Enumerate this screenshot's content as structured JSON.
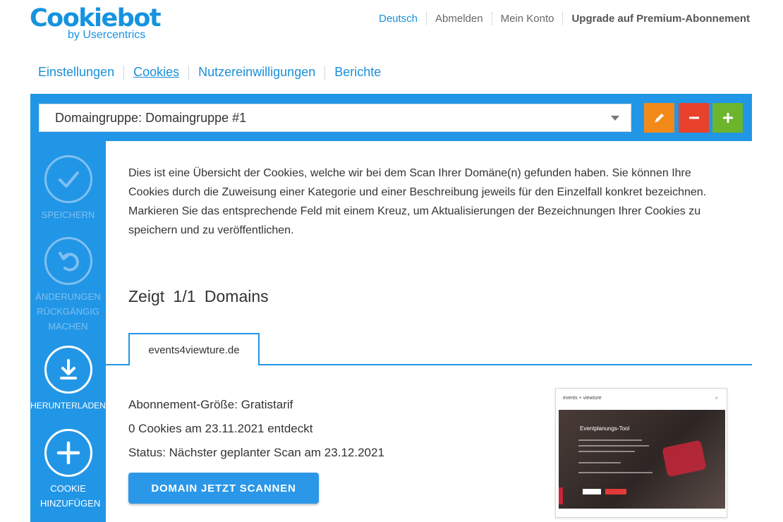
{
  "brand": {
    "name": "Cookiebot",
    "sub": "by Usercentrics",
    "color": "#1593e0"
  },
  "topnav": {
    "language": "Deutsch",
    "logout": "Abmelden",
    "account": "Mein Konto",
    "upgrade": "Upgrade auf Premium-Abonnement"
  },
  "mainnav": {
    "tabs": [
      "Einstellungen",
      "Cookies",
      "Nutzereinwilligungen",
      "Berichte"
    ],
    "active": "Cookies"
  },
  "domain_group": {
    "selected": "Domaingruppe: Domaingruppe #1",
    "buttons": {
      "edit_icon": "pencil-icon",
      "delete_icon": "minus-icon",
      "add_icon": "plus-icon"
    }
  },
  "actions": [
    {
      "label": "SPEICHERN",
      "icon": "checkmark-icon",
      "enabled": false
    },
    {
      "label": "ÄNDERUNGEN RÜCKGÄNGIG MACHEN",
      "icon": "undo-icon",
      "enabled": false
    },
    {
      "label": "HERUNTERLADEN",
      "icon": "download-icon",
      "enabled": true
    },
    {
      "label": "COOKIE HINZUFÜGEN",
      "icon": "add-circle-icon",
      "enabled": true
    }
  ],
  "intro": "Dies ist eine Übersicht der Cookies, welche wir bei dem Scan Ihrer Domäne(n) gefunden haben. Sie können Ihre Cookies durch die Zuweisung einer Kategorie und einer Beschreibung jeweils für den Einzelfall konkret bezeichnen. Markieren Sie das entsprechende Feld mit einem Kreuz, um Aktualisierungen der Bezeichnungen Ihrer Cookies zu speichern und zu veröffentlichen.",
  "shows": "Zeigt 1/1 Domains",
  "domain_tab": "events4viewture.de",
  "info": {
    "subscription": "Abonnement-Größe: Gratistarif",
    "cookies_found": "0 Cookies am 23.11.2021 entdeckt",
    "status": "Status: Nächster geplanter Scan am 23.12.2021"
  },
  "scan_button": "DOMAIN JETZT SCANNEN",
  "thumbnail": {
    "site_logo": "events + viewture",
    "hero_title": "Eventplanungs-Tool"
  },
  "colors": {
    "primary": "#2296e6",
    "edit": "#f28a1a",
    "delete": "#e8412c",
    "add": "#6cb52c",
    "disabled": "#7fbff0"
  }
}
